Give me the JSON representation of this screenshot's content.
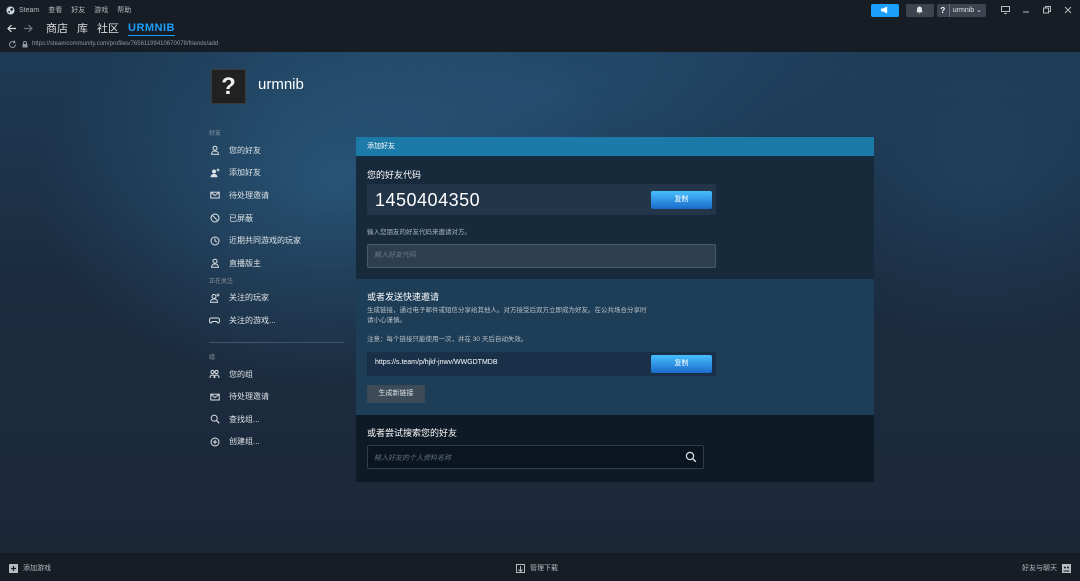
{
  "titlebar": {
    "menu": [
      "Steam",
      "查看",
      "好友",
      "游戏",
      "帮助"
    ],
    "user_q": "?",
    "username": "urmnib ⌄"
  },
  "nav": {
    "tabs": [
      "商店",
      "库",
      "社区",
      "URMNIB"
    ],
    "active_tab": 3
  },
  "url": "https://steamcommunity.com/profiles/76561199410670078/friends/add",
  "profile": {
    "avatar_char": "?",
    "name": "urmnib"
  },
  "sidebar": {
    "friends_header": "好友",
    "friends_items": [
      "您的好友",
      "添加好友",
      "待处理邀请",
      "已屏蔽",
      "近期共同游戏的玩家",
      "直播版主"
    ],
    "following_header": "正在关注",
    "following_items": [
      "关注的玩家",
      "关注的游戏..."
    ],
    "groups_header": "组",
    "groups_items": [
      "您的组",
      "待处理邀请",
      "查找组...",
      "创建组..."
    ]
  },
  "panel": {
    "header": "添加好友",
    "code_title": "您的好友代码",
    "code_value": "1450404350",
    "copy_label": "复制",
    "code_hint": "输入您朋友的好友代码来邀请对方。",
    "code_input_placeholder": "输入好友代码",
    "invite_title": "或者发送快速邀请",
    "invite_desc_line1": "生成链接，通过电子邮件或短信分享给其他人。对方接受后双方立即成为好友。在公共场合分享时",
    "invite_desc_line2": "请小心谨慎。",
    "invite_note": "注意：每个链接只能使用一次，并在 30 天后自动失效。",
    "invite_link": "https://s.team/p/hjkf-jnwv/WWGDTMDB",
    "generate_label": "生成新链接",
    "search_title": "或者尝试搜索您的好友",
    "search_placeholder": "输入好友的个人资料名称"
  },
  "bottombar": {
    "add_game": "添加游戏",
    "manage_downloads": "管理下载",
    "friends_chat": "好友与聊天"
  },
  "colors": {
    "accent": "#1a9fff",
    "panel_header": "#1c7aa9",
    "button_gradient_top": "#47bfff",
    "button_gradient_bottom": "#1a6bc9"
  }
}
